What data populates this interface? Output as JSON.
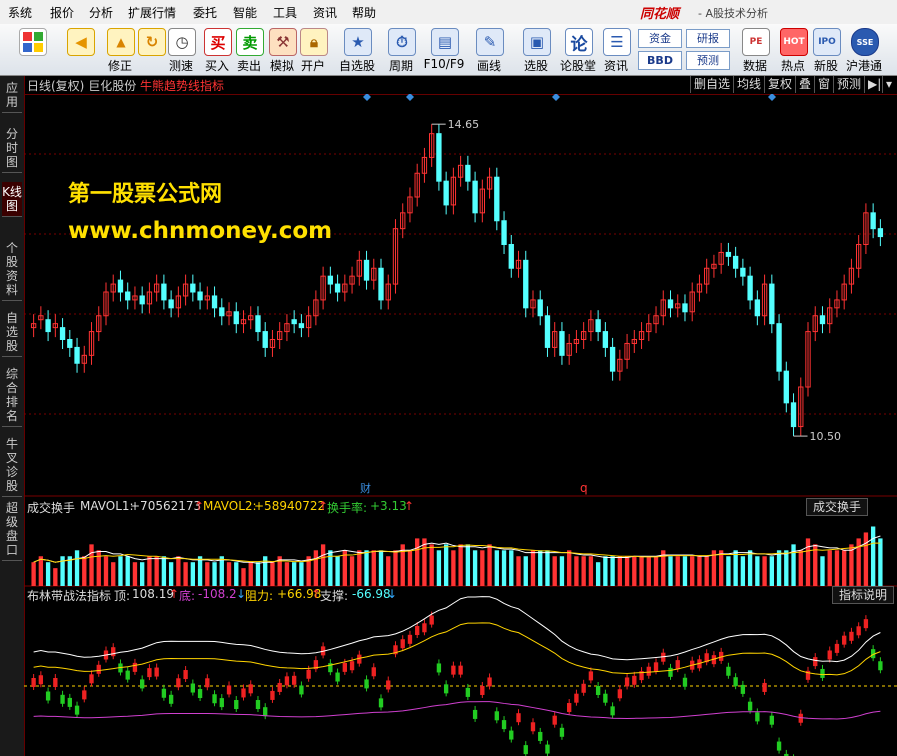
{
  "menubar": {
    "items": [
      "系统",
      "报价",
      "分析",
      "扩展行情",
      "委托",
      "智能",
      "工具",
      "资讯",
      "帮助"
    ],
    "brand": "同花顺",
    "title": "- A股技术分析"
  },
  "toolbar": {
    "buttons": [
      {
        "label": "",
        "icon": "home-icon"
      },
      {
        "label": "",
        "icon": "back-arrow-icon"
      },
      {
        "label": "修正",
        "icon": "arrow-up-down-icon"
      },
      {
        "label": "刷速",
        "icon": "refresh-icon"
      },
      {
        "label": "测速",
        "icon": "clock-icon"
      },
      {
        "label": "买入",
        "icon": "buy-icon",
        "glyph": "买"
      },
      {
        "label": "卖出",
        "icon": "sell-icon",
        "glyph": "卖"
      },
      {
        "label": "模拟",
        "icon": "hammer-icon"
      },
      {
        "label": "开户",
        "icon": "lock-icon"
      },
      {
        "label": "自选股",
        "icon": "star-icon"
      },
      {
        "label": "周期",
        "icon": "clock-cycle-icon"
      },
      {
        "label": "F10/F9",
        "icon": "f10-icon"
      },
      {
        "label": "画线",
        "icon": "pen-icon"
      },
      {
        "label": "选股",
        "icon": "screen-icon"
      },
      {
        "label": "论股堂",
        "icon": "forum-icon",
        "glyph": "论"
      },
      {
        "label": "资讯",
        "icon": "news-icon"
      },
      {
        "label": "数据",
        "icon": "data-icon"
      },
      {
        "label": "热点",
        "icon": "hot-icon"
      },
      {
        "label": "新股",
        "icon": "ipo-icon"
      },
      {
        "label": "沪港通",
        "icon": "hk-icon"
      }
    ],
    "small_buttons": [
      "资金",
      "研报",
      "BBD",
      "预测"
    ]
  },
  "sidebar": {
    "tabs": [
      {
        "label": "应用",
        "active": false
      },
      {
        "label": "分时图",
        "active": false
      },
      {
        "label": "K线图",
        "active": true
      },
      {
        "label": "个股资料",
        "active": false
      },
      {
        "label": "自选股",
        "active": false
      },
      {
        "label": "综合排名",
        "active": false
      },
      {
        "label": "牛叉诊股",
        "active": false
      },
      {
        "label": "超级盘口",
        "active": false
      }
    ]
  },
  "main_chart": {
    "period": "日线(复权)",
    "stock": "巨化股份",
    "indicator": "牛熊趋势线指标",
    "buttons": [
      "删自选",
      "均线",
      "复权",
      "叠",
      "窗",
      "预测"
    ],
    "high_label": "14.65",
    "low_label": "10.50",
    "marker_cai": "财",
    "marker_q": "q",
    "watermark_line1": "第一股票公式网",
    "watermark_line2": "www.chnmoney.com",
    "colors": {
      "up": "#ff3333",
      "down": "#54ffff",
      "grid": "#7a0000",
      "diamond": "#3a8ee0"
    }
  },
  "volume_panel": {
    "name": "成交换手",
    "mavol1_label": "MAVOL1:",
    "mavol1_value": "+70562173",
    "mavol2_label": "MAVOL2:",
    "mavol2_value": "+58940722",
    "turnover_label": "换手率:",
    "turnover_value": "+3.13",
    "button": "成交换手"
  },
  "bb_panel": {
    "name": "布林带战法指标",
    "top_label": "顶:",
    "top_value": "108.19",
    "bottom_label": "底:",
    "bottom_value": "-108.2",
    "resist_label": "阻力:",
    "resist_value": "+66.98",
    "support_label": "支撑:",
    "support_value": "-66.98",
    "button": "指标说明"
  },
  "chart_data": {
    "type": "candlestick",
    "title": "日线(复权) 巨化股份",
    "ylim": [
      10.2,
      15.0
    ],
    "close": [
      12.2,
      12.3,
      12.1,
      12.2,
      12.0,
      11.9,
      11.7,
      11.8,
      12.1,
      12.3,
      12.6,
      12.7,
      12.6,
      12.5,
      12.55,
      12.45,
      12.6,
      12.7,
      12.5,
      12.4,
      12.55,
      12.7,
      12.6,
      12.5,
      12.55,
      12.4,
      12.3,
      12.35,
      12.2,
      12.25,
      12.3,
      12.1,
      11.9,
      12.0,
      12.1,
      12.2,
      12.2,
      12.15,
      12.3,
      12.5,
      12.8,
      12.7,
      12.6,
      12.7,
      12.8,
      13.0,
      12.75,
      12.9,
      12.5,
      12.7,
      13.4,
      13.6,
      13.8,
      14.1,
      14.3,
      14.6,
      14.0,
      13.7,
      14.05,
      14.2,
      14.0,
      13.6,
      13.9,
      14.05,
      13.5,
      13.2,
      12.9,
      13.0,
      12.4,
      12.5,
      12.3,
      11.9,
      12.1,
      11.8,
      11.95,
      12.0,
      12.1,
      12.25,
      12.1,
      11.9,
      11.6,
      11.75,
      11.95,
      12.0,
      12.1,
      12.2,
      12.3,
      12.5,
      12.4,
      12.45,
      12.35,
      12.6,
      12.7,
      12.9,
      12.95,
      13.1,
      13.05,
      12.9,
      12.8,
      12.5,
      12.3,
      12.7,
      12.2,
      11.6,
      11.2,
      10.9,
      11.4,
      12.1,
      12.3,
      12.2,
      12.4,
      12.5,
      12.7,
      12.9,
      13.2,
      13.6,
      13.4,
      13.3
    ],
    "open": [
      12.15,
      12.25,
      12.25,
      12.15,
      12.15,
      12.0,
      11.9,
      11.7,
      11.8,
      12.1,
      12.3,
      12.6,
      12.75,
      12.6,
      12.5,
      12.55,
      12.45,
      12.6,
      12.7,
      12.5,
      12.4,
      12.55,
      12.7,
      12.6,
      12.5,
      12.55,
      12.4,
      12.3,
      12.35,
      12.2,
      12.25,
      12.3,
      12.1,
      11.9,
      12.0,
      12.1,
      12.25,
      12.2,
      12.15,
      12.3,
      12.5,
      12.8,
      12.7,
      12.6,
      12.7,
      12.8,
      13.0,
      12.75,
      12.9,
      12.5,
      12.7,
      13.4,
      13.6,
      13.8,
      14.1,
      14.3,
      14.6,
      14.0,
      13.7,
      14.05,
      14.2,
      14.0,
      13.6,
      13.9,
      14.05,
      13.5,
      13.2,
      12.9,
      13.0,
      12.4,
      12.5,
      12.3,
      11.9,
      12.1,
      11.8,
      11.95,
      12.0,
      12.1,
      12.25,
      12.1,
      11.9,
      11.6,
      11.75,
      11.95,
      12.0,
      12.1,
      12.2,
      12.3,
      12.5,
      12.4,
      12.45,
      12.35,
      12.6,
      12.7,
      12.9,
      12.95,
      13.1,
      13.05,
      12.9,
      12.8,
      12.5,
      12.3,
      12.7,
      12.2,
      11.6,
      11.2,
      10.9,
      11.4,
      12.1,
      12.3,
      12.2,
      12.4,
      12.5,
      12.7,
      12.9,
      13.2,
      13.6,
      13.4
    ],
    "volume_scale": [
      0.4,
      0.5,
      0.4,
      0.3,
      0.5,
      0.5,
      0.6,
      0.5,
      0.7,
      0.6,
      0.5,
      0.4,
      0.5,
      0.5,
      0.4,
      0.4,
      0.5,
      0.5,
      0.5,
      0.4,
      0.5,
      0.4,
      0.4,
      0.5,
      0.4,
      0.4,
      0.5,
      0.4,
      0.4,
      0.3,
      0.4,
      0.4,
      0.5,
      0.4,
      0.5,
      0.4,
      0.4,
      0.4,
      0.5,
      0.6,
      0.7,
      0.6,
      0.5,
      0.6,
      0.5,
      0.6,
      0.6,
      0.6,
      0.6,
      0.5,
      0.6,
      0.7,
      0.6,
      0.8,
      0.8,
      0.7,
      0.6,
      0.7,
      0.6,
      0.7,
      0.7,
      0.6,
      0.6,
      0.7,
      0.6,
      0.6,
      0.6,
      0.5,
      0.5,
      0.6,
      0.6,
      0.6,
      0.5,
      0.5,
      0.6,
      0.5,
      0.5,
      0.5,
      0.4,
      0.5,
      0.5,
      0.5,
      0.5,
      0.5,
      0.5,
      0.5,
      0.5,
      0.6,
      0.5,
      0.5,
      0.5,
      0.5,
      0.5,
      0.5,
      0.6,
      0.6,
      0.5,
      0.6,
      0.5,
      0.6,
      0.5,
      0.5,
      0.5,
      0.6,
      0.6,
      0.7,
      0.6,
      0.8,
      0.7,
      0.5,
      0.6,
      0.6,
      0.6,
      0.7,
      0.8,
      0.9,
      1.0,
      0.8,
      0.7
    ]
  }
}
